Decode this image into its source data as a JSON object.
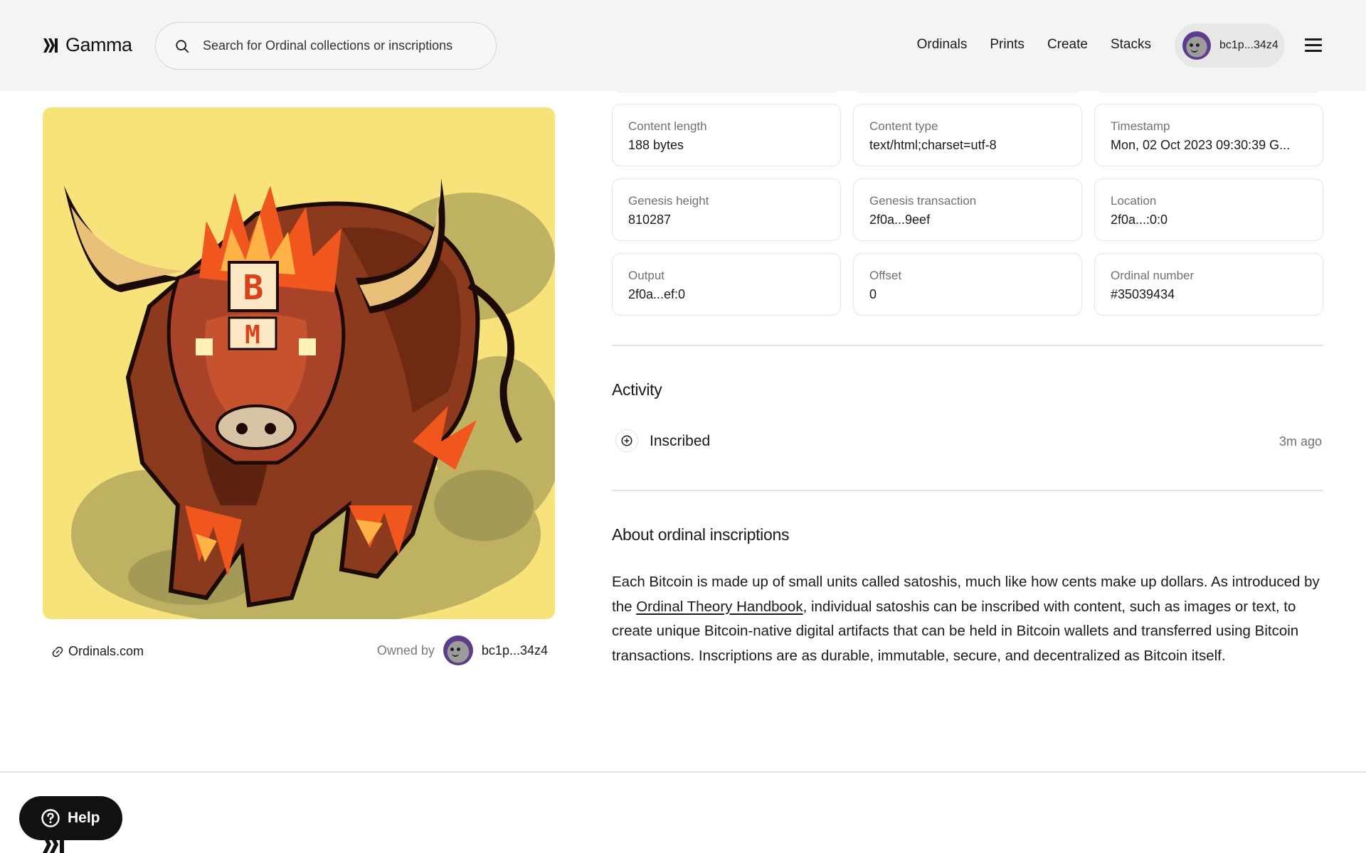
{
  "header": {
    "logo_text": "Gamma",
    "search_placeholder": "Search for Ordinal collections or inscriptions",
    "nav": [
      "Ordinals",
      "Prints",
      "Create",
      "Stacks"
    ],
    "account_address": "bc1p...34z4"
  },
  "artwork": {
    "source_link": "Ordinals.com",
    "owned_by_label": "Owned by",
    "owner_address": "bc1p...34z4"
  },
  "details": [
    {
      "label": "Content length",
      "value": "188 bytes"
    },
    {
      "label": "Content type",
      "value": "text/html;charset=utf-8"
    },
    {
      "label": "Timestamp",
      "value": "Mon, 02 Oct 2023 09:30:39 G..."
    },
    {
      "label": "Genesis height",
      "value": "810287"
    },
    {
      "label": "Genesis transaction",
      "value": "2f0a...9eef"
    },
    {
      "label": "Location",
      "value": "2f0a...:0:0"
    },
    {
      "label": "Output",
      "value": "2f0a...ef:0"
    },
    {
      "label": "Offset",
      "value": "0"
    },
    {
      "label": "Ordinal number",
      "value": "#35039434"
    }
  ],
  "activity": {
    "title": "Activity",
    "items": [
      {
        "label": "Inscribed",
        "time": "3m ago"
      }
    ]
  },
  "about": {
    "title": "About ordinal inscriptions",
    "text_before": "Each Bitcoin is made up of small units called satoshis, much like how cents make up dollars. As introduced by the ",
    "link_text": "Ordinal Theory Handbook",
    "text_after": ", individual satoshis can be inscribed with content, such as images or text, to create unique Bitcoin-native digital artifacts that can be held in Bitcoin wallets and transferred using Bitcoin transactions. Inscriptions are as durable, immutable, secure, and decentralized as Bitcoin itself."
  },
  "help": {
    "label": "Help"
  },
  "colors": {
    "accent": "#111111",
    "art_background": "#f7e37a",
    "bull_body": "#8c3a1e",
    "flame": "#f0561d"
  }
}
